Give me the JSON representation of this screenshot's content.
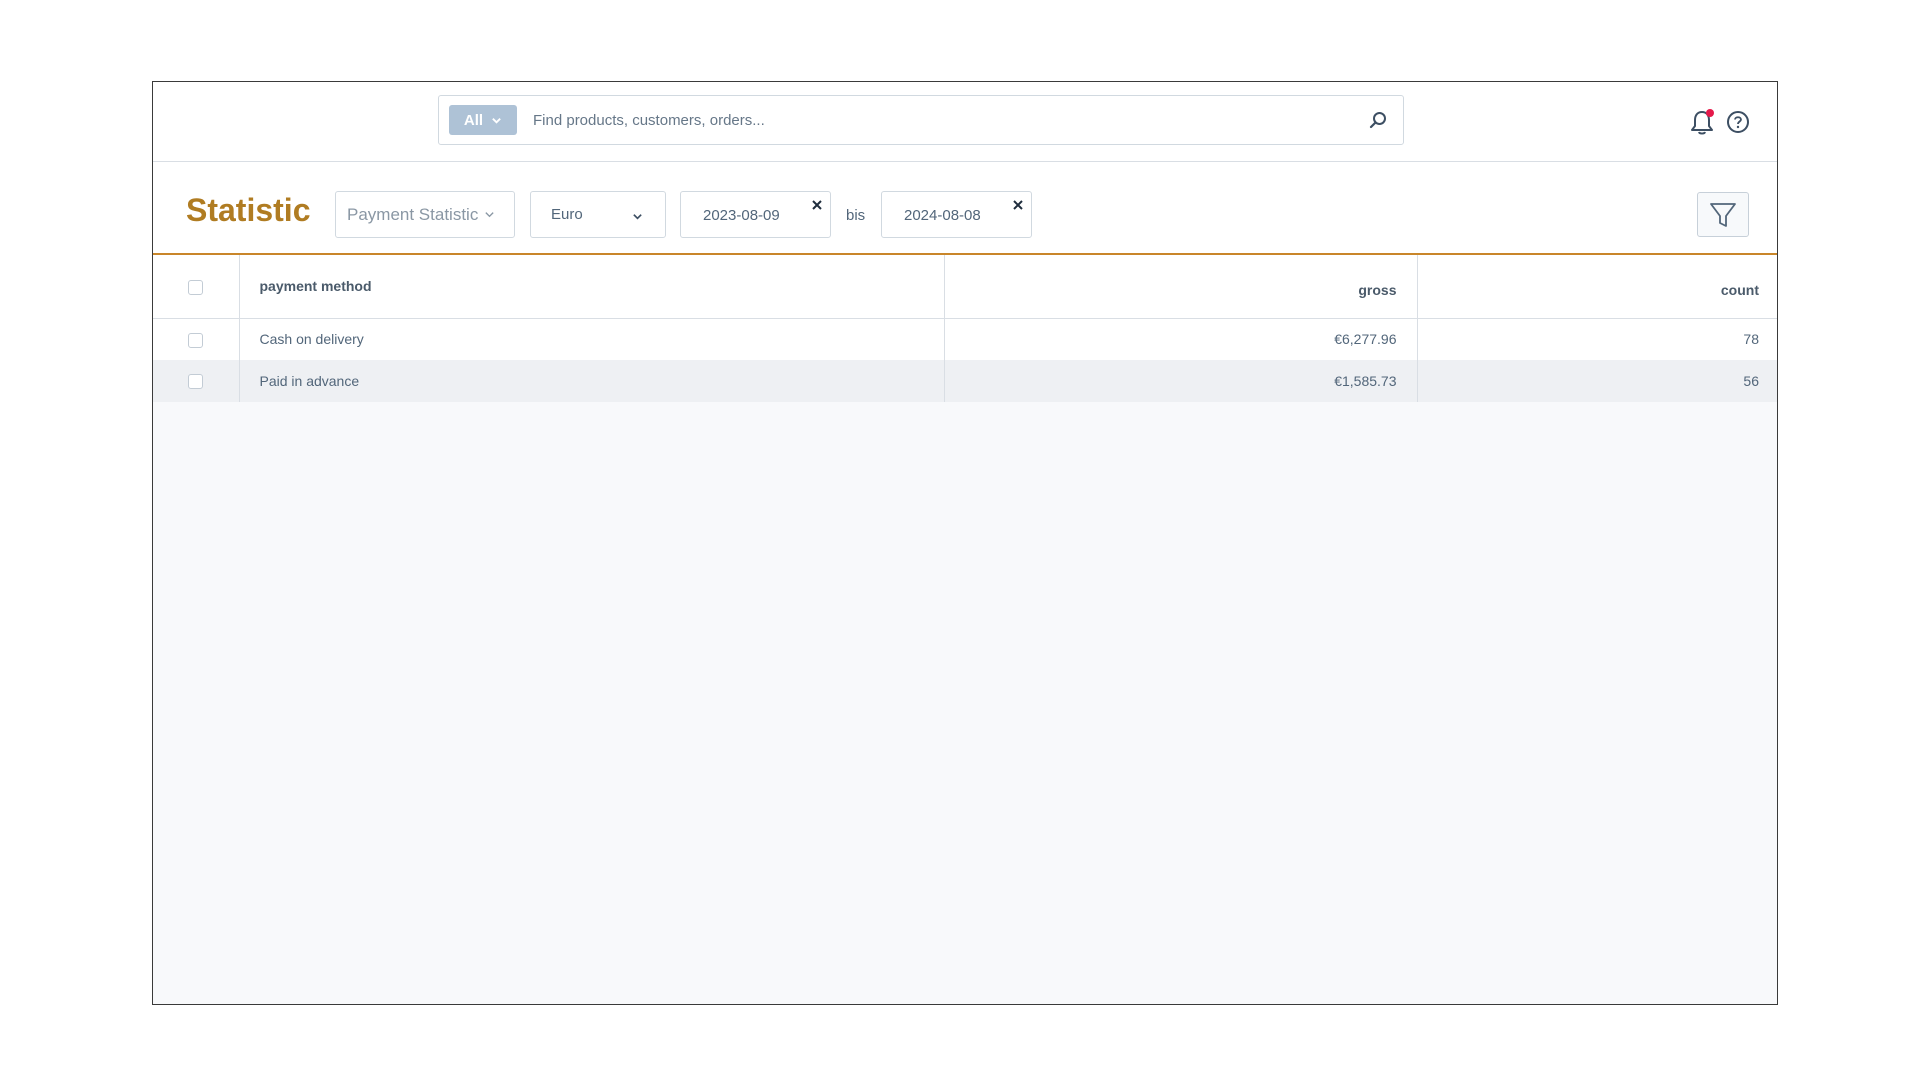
{
  "header": {
    "search": {
      "scope_label": "All",
      "placeholder": "Find products, customers, orders..."
    }
  },
  "toolbar": {
    "title": "Statistic",
    "report_select": "Payment Statistic",
    "currency_select": "Euro",
    "date_from": "2023-08-09",
    "date_separator": "bis",
    "date_to": "2024-08-08"
  },
  "table": {
    "columns": [
      "payment method",
      "gross",
      "count"
    ],
    "rows": [
      {
        "method": "Cash on delivery",
        "gross": "€6,277.96",
        "count": "78"
      },
      {
        "method": "Paid in advance",
        "gross": "€1,585.73",
        "count": "56"
      }
    ]
  },
  "colors": {
    "accent": "#b07c22",
    "toolbar_border": "#c9862a",
    "scope_button": "#aec2d6",
    "notification_dot": "#e5194a"
  }
}
